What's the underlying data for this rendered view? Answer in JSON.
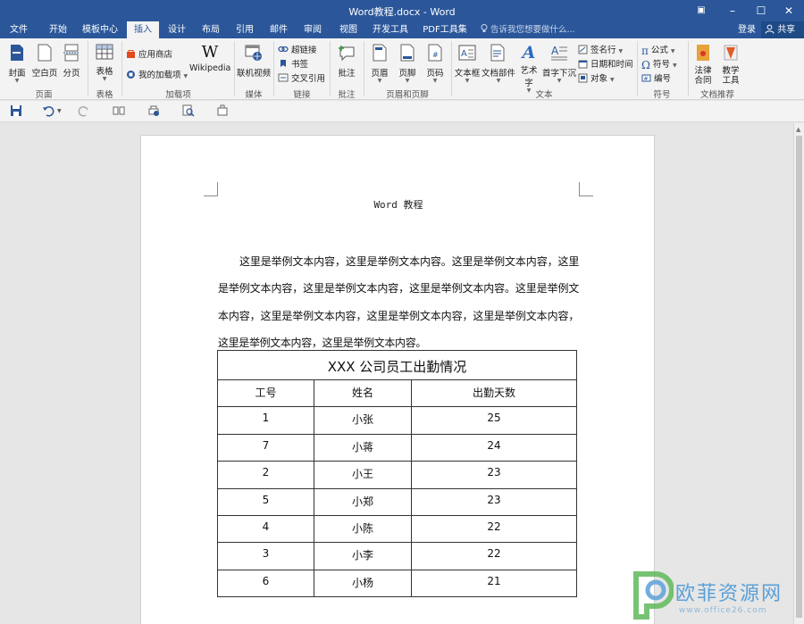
{
  "window": {
    "title": "Word教程.docx - Word",
    "controls": {
      "ribbon_display": "▣",
      "minimize": "–",
      "restore": "☐",
      "close": "✕"
    }
  },
  "tabs": [
    {
      "label": "文件"
    },
    {
      "label": "开始"
    },
    {
      "label": "模板中心"
    },
    {
      "label": "插入",
      "active": true
    },
    {
      "label": "设计"
    },
    {
      "label": "布局"
    },
    {
      "label": "引用"
    },
    {
      "label": "邮件"
    },
    {
      "label": "审阅"
    },
    {
      "label": "视图"
    },
    {
      "label": "开发工具"
    },
    {
      "label": "PDF工具集"
    }
  ],
  "tell_me": "告诉我您想要做什么...",
  "login": "登录",
  "share": "共享",
  "ribbon": {
    "pages": {
      "cover": "封面",
      "blank": "空白页",
      "break": "分页",
      "group": "页面"
    },
    "tables": {
      "table": "表格",
      "group": "表格"
    },
    "addins": {
      "store": "应用商店",
      "my_addins": "我的加载项",
      "wikipedia": "Wikipedia",
      "group": "加载项"
    },
    "media": {
      "online_video": "联机视频",
      "group": "媒体"
    },
    "links": {
      "hyperlink": "超链接",
      "bookmark": "书签",
      "cross_ref": "交叉引用",
      "group": "链接"
    },
    "comments": {
      "comment": "批注",
      "group": "批注"
    },
    "header_footer": {
      "header": "页眉",
      "footer": "页脚",
      "page_number": "页码",
      "group": "页眉和页脚"
    },
    "text": {
      "textbox": "文本框",
      "parts": "文档部件",
      "wordart": "艺术字",
      "dropcap": "首字下沉",
      "signature": "签名行",
      "datetime": "日期和时间",
      "object": "对象",
      "group": "文本"
    },
    "symbols": {
      "equation": "公式",
      "symbol": "符号",
      "number": "编号",
      "group": "符号"
    },
    "recommend": {
      "law": "法律\n合同",
      "teach": "教学\n工具",
      "law_l1": "法律",
      "law_l2": "合同",
      "teach_l1": "教学",
      "teach_l2": "工具",
      "group": "文档推荐"
    }
  },
  "document": {
    "header": "Word 教程",
    "paragraph": "这里是举例文本内容，这里是举例文本内容。这里是举例文本内容，这里是举例文本内容，这里是举例文本内容，这里是举例文本内容。这里是举例文本内容，这里是举例文本内容，这里是举例文本内容，这里是举例文本内容，这里是举例文本内容，这里是举例文本内容。",
    "table": {
      "caption": "XXX 公司员工出勤情况",
      "headers": [
        "工号",
        "姓名",
        "出勤天数"
      ],
      "rows": [
        [
          "1",
          "小张",
          "25"
        ],
        [
          "7",
          "小蒋",
          "24"
        ],
        [
          "2",
          "小王",
          "23"
        ],
        [
          "5",
          "小郑",
          "23"
        ],
        [
          "4",
          "小陈",
          "22"
        ],
        [
          "3",
          "小李",
          "22"
        ],
        [
          "6",
          "小杨",
          "21"
        ]
      ]
    }
  },
  "watermark": {
    "name": "欧菲资源网",
    "url": "www.office26.com"
  },
  "colors": {
    "accent": "#2b579a",
    "ribbon_bg": "#f3f3f3",
    "canvas_bg": "#e6e6e6"
  }
}
